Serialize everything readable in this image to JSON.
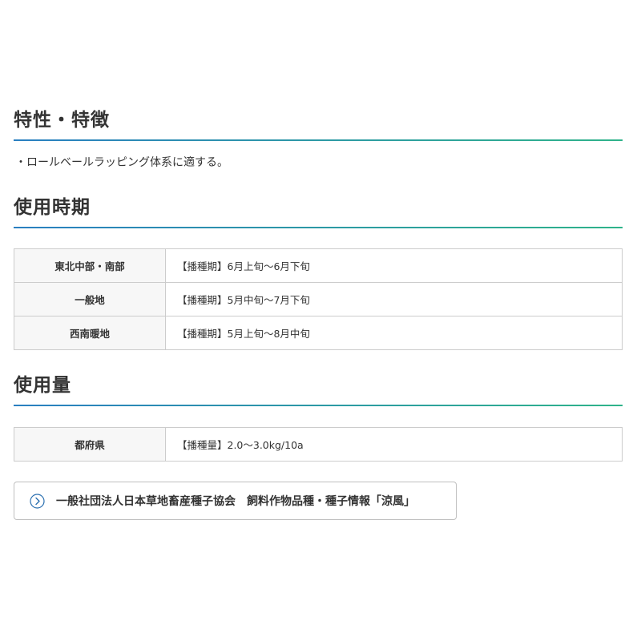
{
  "sections": {
    "features": {
      "title": "特性・特徴",
      "bullet": "・ロールベールラッピング体系に適する。"
    },
    "usage_period": {
      "title": "使用時期",
      "rows": [
        {
          "label": "東北中部・南部",
          "value": "【播種期】6月上旬～6月下旬"
        },
        {
          "label": "一般地",
          "value": "【播種期】5月中旬～7月下旬"
        },
        {
          "label": "西南暖地",
          "value": "【播種期】5月上旬～8月中旬"
        }
      ]
    },
    "usage_amount": {
      "title": "使用量",
      "rows": [
        {
          "label": "都府県",
          "value": "【播種量】2.0～3.0kg/10a"
        }
      ]
    }
  },
  "link": {
    "icon": "chevron-right-circle-icon",
    "text": "一般社団法人日本草地畜産種子協会　飼料作物品種・種子情報「涼風」"
  },
  "colors": {
    "rule_start": "#2a7fc1",
    "rule_end": "#2fb38a",
    "label_bg": "#f7f7f7",
    "border": "#cccccc",
    "icon": "#2a6fb0"
  }
}
